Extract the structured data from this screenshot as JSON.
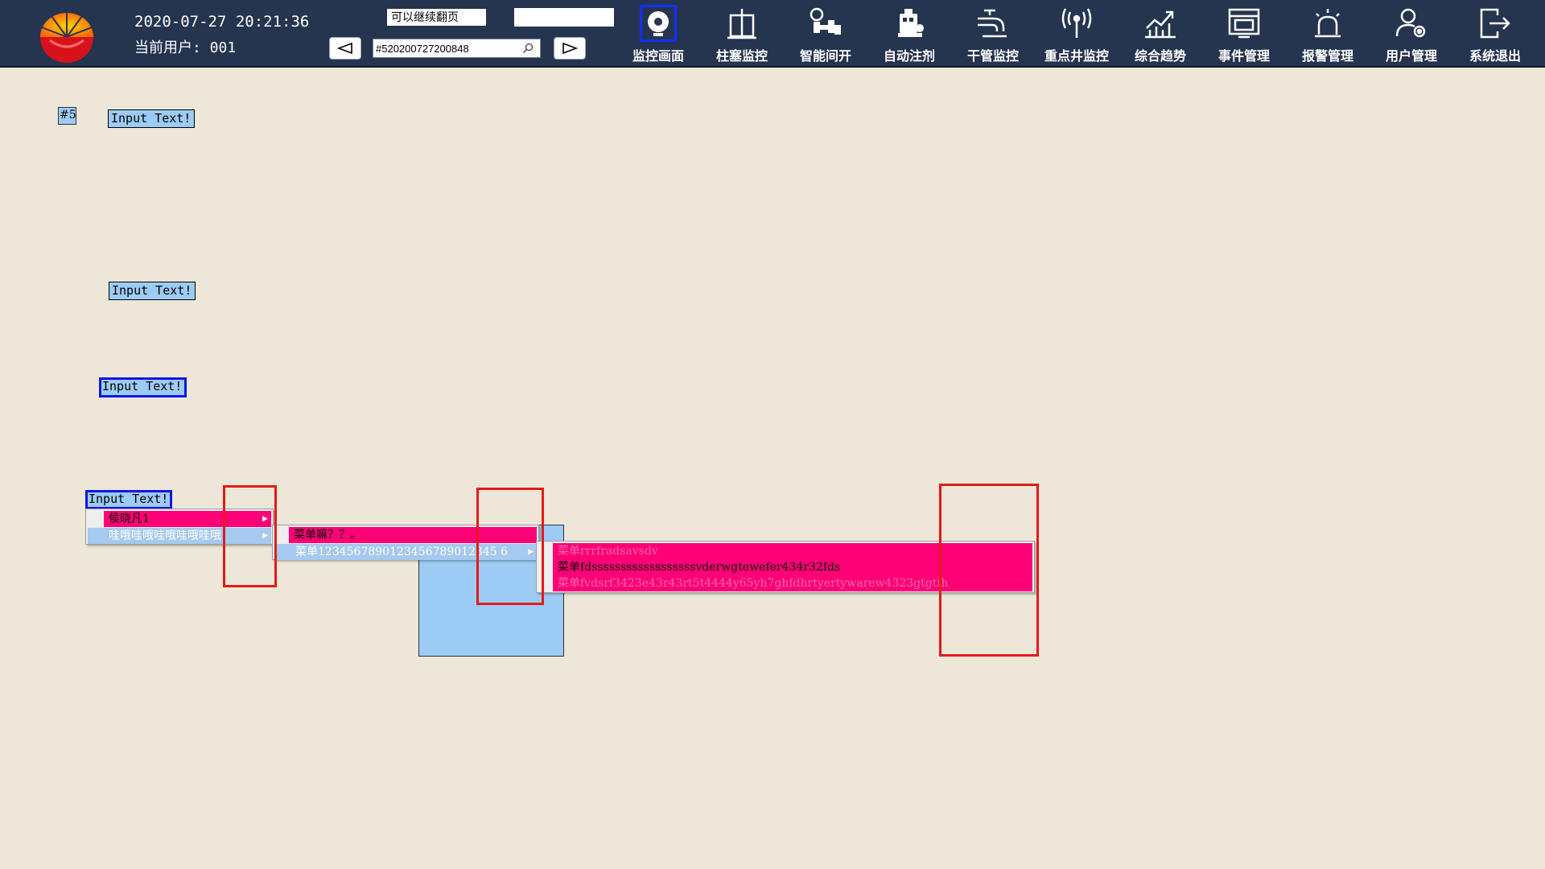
{
  "header": {
    "datetime": "2020-07-27 20:21:36",
    "user": "当前用户: 001",
    "page_note": "可以继续翻页",
    "search_value": "#520200727200848",
    "nav": [
      {
        "label": "监控画面",
        "icon": "monitor-icon",
        "active": true
      },
      {
        "label": "柱塞监控",
        "icon": "plunger-icon"
      },
      {
        "label": "智能间开",
        "icon": "valve-icon"
      },
      {
        "label": "自动注剂",
        "icon": "injection-icon"
      },
      {
        "label": "干管监控",
        "icon": "pipe-icon"
      },
      {
        "label": "重点井监控",
        "icon": "antenna-icon"
      },
      {
        "label": "综合趋势",
        "icon": "trend-chart-icon"
      },
      {
        "label": "事件管理",
        "icon": "event-icon"
      },
      {
        "label": "报警管理",
        "icon": "alarm-icon"
      },
      {
        "label": "用户管理",
        "icon": "user-settings-icon"
      },
      {
        "label": "系统退出",
        "icon": "exit-icon"
      }
    ]
  },
  "content": {
    "tag": "#5",
    "input_text": "Input Text!"
  },
  "menus": {
    "level1": [
      "侯晓凡1",
      "哇哦哇哦哇哦哇哦哇哦"
    ],
    "level2": [
      "菜单嘛？？。",
      "菜单1234567890123456789012345 6"
    ],
    "level3": [
      "菜单rrrfradsavsdv",
      "菜单fdssssssssssssssssssvderwgtewefer434r32fds",
      "菜单fvdsrf3423e43r43rt5t4444y65yh7ghfdhrtyertywarew4323gtgtfh"
    ]
  },
  "colors": {
    "header_bg": "#25344f",
    "page_bg": "#ece7d8",
    "menu_selected": "#ff0077",
    "menu_blue": "#a6c9ef",
    "highlight": "#e51a1a"
  }
}
